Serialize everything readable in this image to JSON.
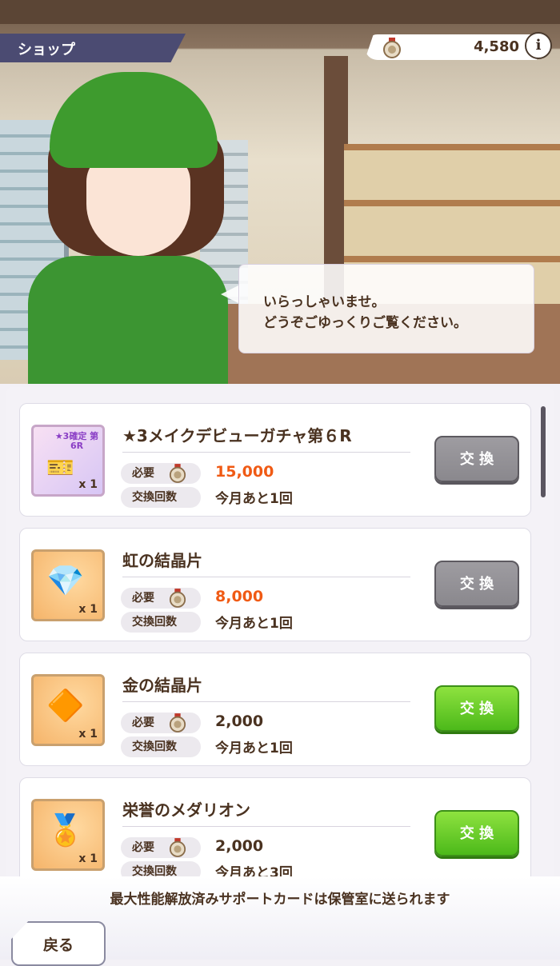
{
  "header": {
    "title": "ショップ",
    "currency_amount": "4,580",
    "info_label": "i"
  },
  "dialog": {
    "line1": "いらっしゃいませ。",
    "line2": "どうぞごゆっくりご覧ください。"
  },
  "labels": {
    "required": "必要",
    "exchange_count": "交換回数",
    "exchange_button": "交 換"
  },
  "items": [
    {
      "name": "★3メイクデビューガチャ第６R",
      "cost": "15,000",
      "limit": "今月あと1回",
      "qty": "x 1",
      "icon": "ticket-icon",
      "tag": "★3確定 第6R",
      "button_state": "disabled"
    },
    {
      "name": "虹の結晶片",
      "cost": "8,000",
      "limit": "今月あと1回",
      "qty": "x 1",
      "icon": "rainbow-crystal-icon",
      "button_state": "disabled"
    },
    {
      "name": "金の結晶片",
      "cost": "2,000",
      "limit": "今月あと1回",
      "qty": "x 1",
      "icon": "gold-crystal-icon",
      "button_state": "active"
    },
    {
      "name": "栄誉のメダリオン",
      "cost": "2,000",
      "limit": "今月あと3回",
      "qty": "x 1",
      "icon": "medallion-icon",
      "button_state": "active"
    }
  ],
  "footer": {
    "notice": "最大性能解放済みサポートカードは保管室に送られます",
    "back_label": "戻る"
  },
  "colors": {
    "accent_green": "#4cb91a",
    "cost_red": "#f05a14",
    "title_bar": "#4b4b72"
  }
}
